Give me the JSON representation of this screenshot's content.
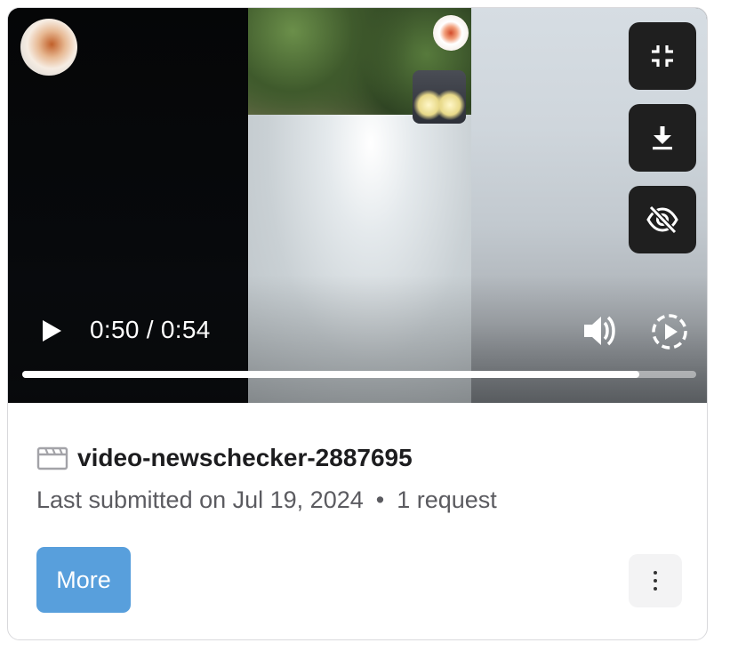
{
  "video": {
    "current_time": "0:50",
    "duration": "0:54",
    "time_display": "0:50 / 0:54",
    "progress": 0.915,
    "controls": {
      "exit_fullscreen_icon": "exit-fullscreen-icon",
      "download_icon": "download-icon",
      "hide_icon": "eye-off-icon",
      "play_icon": "play-icon",
      "volume_icon": "volume-icon",
      "speed_icon": "playback-speed-icon"
    }
  },
  "item": {
    "icon": "clapperboard-icon",
    "title": "video-newschecker-2887695",
    "submitted_text": "Last submitted on Jul 19, 2024",
    "separator": "•",
    "request_count": "1 request"
  },
  "actions": {
    "more_label": "More",
    "kebab_icon": "more-vertical-icon"
  },
  "colors": {
    "accent": "#589fdc",
    "control_bg": "#1f1f1f"
  }
}
